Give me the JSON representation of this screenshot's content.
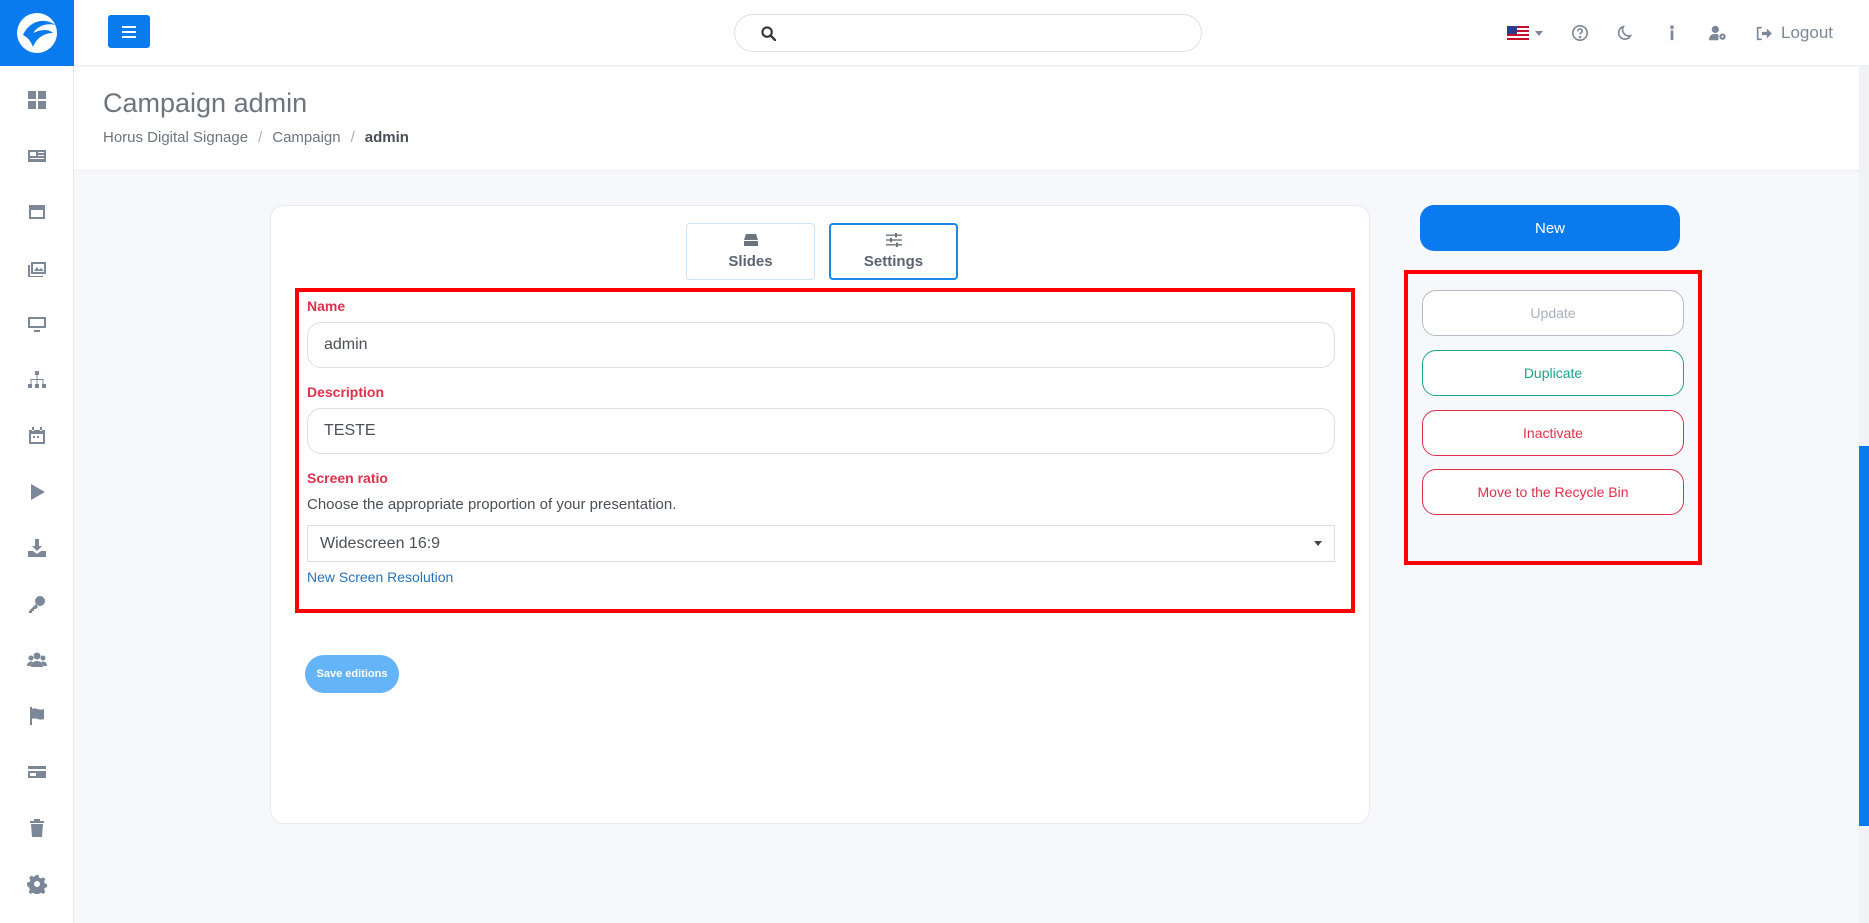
{
  "header": {
    "search_placeholder": "",
    "logout_label": "Logout"
  },
  "page": {
    "title": "Campaign admin",
    "breadcrumb": [
      "Horus Digital Signage",
      "Campaign",
      "admin"
    ]
  },
  "tabs": [
    {
      "label": "Slides",
      "icon": "stack-icon"
    },
    {
      "label": "Settings",
      "icon": "sliders-icon"
    }
  ],
  "form": {
    "name_label": "Name",
    "name_value": "admin",
    "description_label": "Description",
    "description_value": "TESTE",
    "ratio_label": "Screen ratio",
    "ratio_hint": "Choose the appropriate proportion of your presentation.",
    "ratio_value": "Widescreen 16:9",
    "new_resolution_link": "New Screen Resolution",
    "save_label": "Save editions"
  },
  "actions": {
    "new_label": "New",
    "update_label": "Update",
    "duplicate_label": "Duplicate",
    "inactivate_label": "Inactivate",
    "recycle_label": "Move to the Recycle Bin"
  },
  "colors": {
    "primary": "#0a7bef",
    "danger": "#e0304b",
    "success": "#1aa58d",
    "highlight": "#ff0000"
  }
}
